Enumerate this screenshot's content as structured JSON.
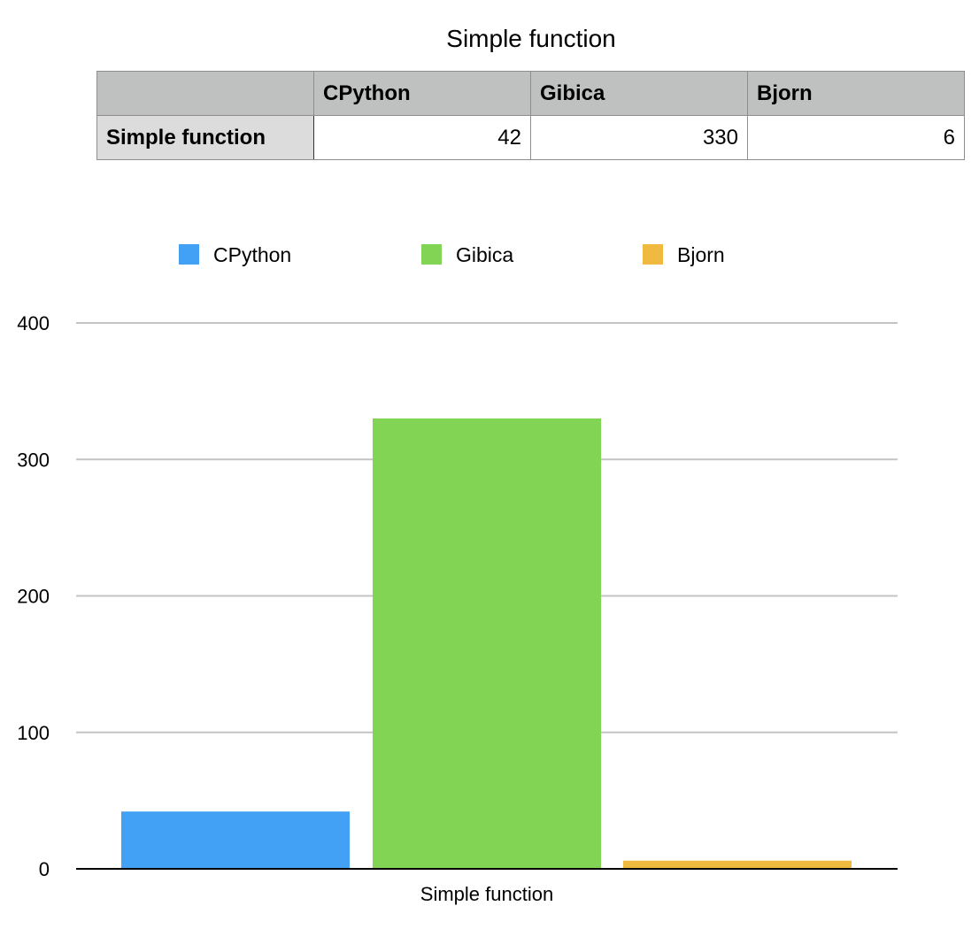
{
  "title": "Simple function",
  "table": {
    "columns": [
      "CPython",
      "Gibica",
      "Bjorn"
    ],
    "rows": [
      {
        "label": "Simple function",
        "values": [
          "42",
          "330",
          "6"
        ]
      }
    ]
  },
  "chart_data": {
    "type": "bar",
    "categories": [
      "Simple function"
    ],
    "series": [
      {
        "name": "CPython",
        "values": [
          42
        ],
        "color": "#42a1f5"
      },
      {
        "name": "Gibica",
        "values": [
          330
        ],
        "color": "#82d455"
      },
      {
        "name": "Bjorn",
        "values": [
          6
        ],
        "color": "#f0ba40"
      }
    ],
    "ylim": [
      0,
      400
    ],
    "yticks": [
      0,
      100,
      200,
      300,
      400
    ],
    "legend_position": "top",
    "grid": true,
    "xlabel": "",
    "ylabel": ""
  }
}
